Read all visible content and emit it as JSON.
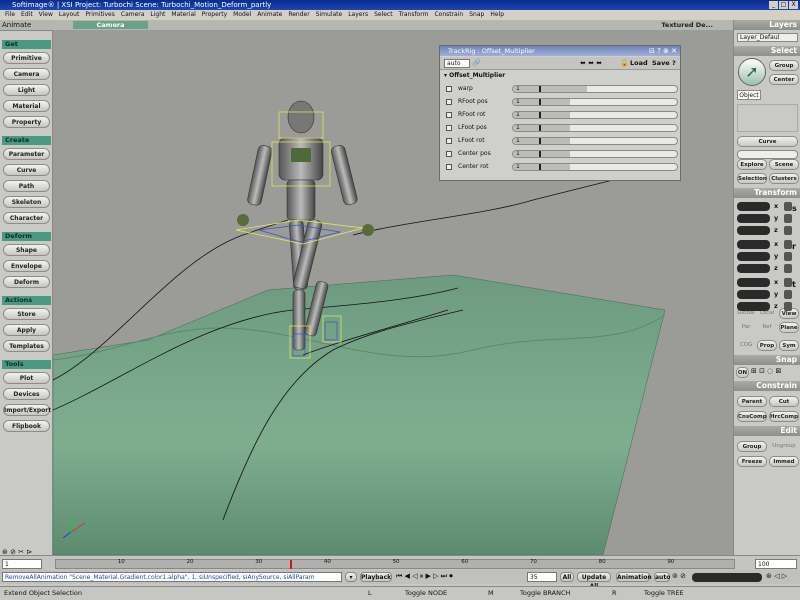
{
  "window": {
    "title": "Softimage® | XSI Project: Turbochi    Scene: Turbochi_Motion_Deform_partly",
    "controls": [
      "_",
      "□",
      "X"
    ]
  },
  "menu": [
    "File",
    "Edit",
    "View",
    "Layout",
    "Primitives",
    "Camera",
    "Light",
    "Material",
    "Property",
    "Model",
    "Animate",
    "Render",
    "Simulate",
    "Layers",
    "Select",
    "Transform",
    "Constrain",
    "Snap",
    "Help"
  ],
  "left_panel": {
    "mode": "Animate",
    "sections": [
      {
        "title": "Get",
        "buttons": [
          "Primitive",
          "Camera",
          "Light",
          "Material",
          "Property"
        ]
      },
      {
        "title": "Create",
        "buttons": [
          "Parameter",
          "Curve",
          "Path",
          "Skeleton",
          "Character"
        ]
      },
      {
        "title": "Deform",
        "buttons": [
          "Shape",
          "Envelope",
          "Deform"
        ]
      },
      {
        "title": "Actions",
        "buttons": [
          "Store",
          "Apply",
          "Templates"
        ]
      },
      {
        "title": "Tools",
        "buttons": [
          "Plot",
          "Devices",
          "Import/Export",
          "Flipbook"
        ]
      }
    ]
  },
  "viewport": {
    "camera": "Camera",
    "shading": "Textured De...",
    "ground_color": "#5d8f72"
  },
  "trackrig": {
    "title": "TrackRig : Offset_Multiplier",
    "auto_label": "auto",
    "load_label": "Load",
    "save_label": "Save",
    "help_label": "?",
    "group": "Offset_Multiplier",
    "params": [
      {
        "name": "warp",
        "value": "1",
        "fill": 0.45
      },
      {
        "name": "RFoot pos",
        "value": "1",
        "fill": 0.35
      },
      {
        "name": "RFoot rot",
        "value": "1",
        "fill": 0.35
      },
      {
        "name": "LFoot pos",
        "value": "1",
        "fill": 0.35
      },
      {
        "name": "LFoot rot",
        "value": "1",
        "fill": 0.35
      },
      {
        "name": "Center pos",
        "value": "1",
        "fill": 0.35
      },
      {
        "name": "Center rot",
        "value": "1",
        "fill": 0.35
      }
    ]
  },
  "right_panel": {
    "layers_title": "Layers",
    "layer_value": "Layer_Defaul",
    "select_title": "Select",
    "group_label": "Group",
    "center_label": "Center",
    "object_label": "Object",
    "curve_label": "Curve",
    "explore_label": "Explore",
    "scene_label": "Scene",
    "selection_label": "Selection",
    "clusters_label": "Clusters",
    "transform_title": "Transform",
    "axes": [
      "x",
      "y",
      "z",
      "x",
      "y",
      "z",
      "x",
      "y",
      "z"
    ],
    "transform_modes": [
      "s",
      "r",
      "t"
    ],
    "global_label": "Global",
    "local_label": "Local",
    "view_label": "View",
    "par_label": "Par",
    "ref_label": "Ref",
    "plane_label": "Plane",
    "cog_label": "COG",
    "prop_label": "Prop",
    "sym_label": "Sym",
    "snap_title": "Snap",
    "on_label": "ON",
    "constrain_title": "Constrain",
    "parent_label": "Parent",
    "cut_label": "Cut",
    "cnscomp_label": "CnsComp",
    "hrccomp_label": "HrcComp",
    "edit_title": "Edit",
    "edit_group_label": "Group",
    "ungroup_label": "Ungroup",
    "freeze_label": "Freeze",
    "immed_label": "Immed"
  },
  "timeline": {
    "start": "1",
    "end": "100",
    "ticks": [
      "10",
      "20",
      "30",
      "40",
      "50",
      "60",
      "70",
      "80",
      "90"
    ],
    "current_frame": 35
  },
  "command": {
    "text": "RemoveAllAnimation \"Scene_Material.Gradient.color1.alpha\", 1, siUnspecified, siAnySource, siAllParam",
    "playback_label": "Playback",
    "frame_value": "35",
    "all_label": "All",
    "update_all_label": "Update All",
    "animation_label": "Animation",
    "auto_label": "auto"
  },
  "status": {
    "left": "Extend Object Selection",
    "l_key": "L",
    "node": "Toggle NODE",
    "m_key": "M",
    "branch": "Toggle BRANCH",
    "r_key": "R",
    "tree": "Toggle TREE"
  }
}
